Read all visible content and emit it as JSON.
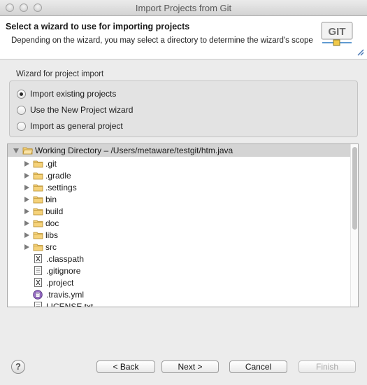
{
  "window": {
    "title": "Import Projects from Git"
  },
  "header": {
    "title": "Select a wizard to use for importing projects",
    "description": "Depending on the wizard, you may select a directory to determine the wizard's scope",
    "logo_text": "GIT"
  },
  "wizard_group": {
    "label": "Wizard for project import",
    "options": [
      {
        "label": "Import existing projects",
        "selected": true
      },
      {
        "label": "Use the New Project wizard",
        "selected": false
      },
      {
        "label": "Import as general project",
        "selected": false
      }
    ]
  },
  "tree": {
    "root": {
      "label": "Working Directory – /Users/metaware/testgit/htm.java",
      "expanded": true
    },
    "children": [
      {
        "label": ".git",
        "type": "folder",
        "icon": "folder-icon"
      },
      {
        "label": ".gradle",
        "type": "folder",
        "icon": "folder-icon"
      },
      {
        "label": ".settings",
        "type": "folder",
        "icon": "folder-icon"
      },
      {
        "label": "bin",
        "type": "folder",
        "icon": "folder-icon"
      },
      {
        "label": "build",
        "type": "folder",
        "icon": "folder-icon"
      },
      {
        "label": "doc",
        "type": "folder",
        "icon": "folder-icon"
      },
      {
        "label": "libs",
        "type": "folder",
        "icon": "folder-icon"
      },
      {
        "label": "src",
        "type": "folder",
        "icon": "folder-icon"
      },
      {
        "label": ".classpath",
        "type": "file",
        "icon": "x-file-icon"
      },
      {
        "label": ".gitignore",
        "type": "file",
        "icon": "x-file-icon"
      },
      {
        "label": ".project",
        "type": "file",
        "icon": "x-file-icon"
      },
      {
        "label": ".travis.yml",
        "type": "file",
        "icon": "yml-file-icon"
      },
      {
        "label": "LICENSE.txt",
        "type": "file",
        "icon": "text-file-icon"
      }
    ]
  },
  "buttons": {
    "help": "?",
    "back": "< Back",
    "next": "Next >",
    "cancel": "Cancel",
    "finish": "Finish",
    "finish_enabled": false
  },
  "colors": {
    "dialog_background": "#ececec",
    "tree_root_highlight": "#d4d4d4",
    "folder": "#f5d27a",
    "disabled_text": "#a8a8a8"
  }
}
